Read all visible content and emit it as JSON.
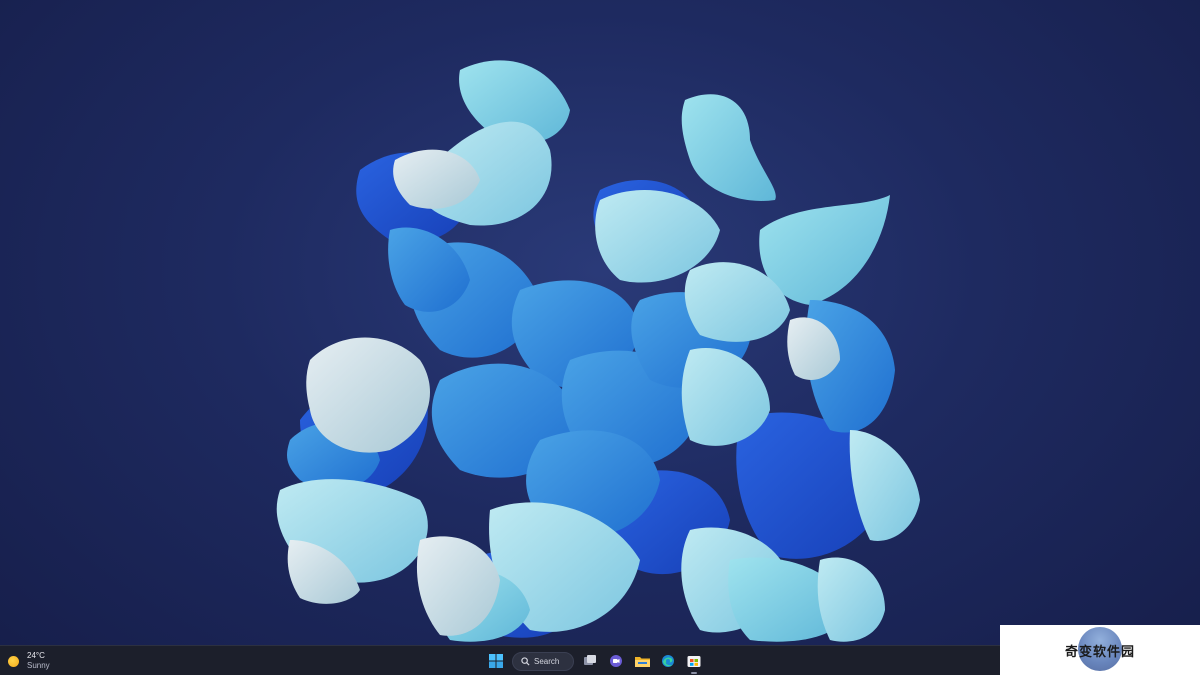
{
  "weather": {
    "icon": "sun-icon",
    "temperature": "24°C",
    "condition": "Sunny"
  },
  "taskbar": {
    "search": {
      "label": "Search",
      "icon": "search-icon"
    },
    "pinned": [
      {
        "name": "start-button",
        "icon": "windows-logo-icon"
      },
      {
        "name": "task-view-button",
        "icon": "task-view-icon"
      },
      {
        "name": "chat-button",
        "icon": "chat-icon"
      },
      {
        "name": "file-explorer-button",
        "icon": "folder-icon"
      },
      {
        "name": "edge-button",
        "icon": "edge-icon"
      },
      {
        "name": "store-button",
        "icon": "store-icon"
      }
    ],
    "accent": "#4cc2ff"
  },
  "watermark": {
    "text": "奇变软件园"
  },
  "colors": {
    "background": "#1e2a60",
    "taskbar": "#1c1f2b"
  }
}
